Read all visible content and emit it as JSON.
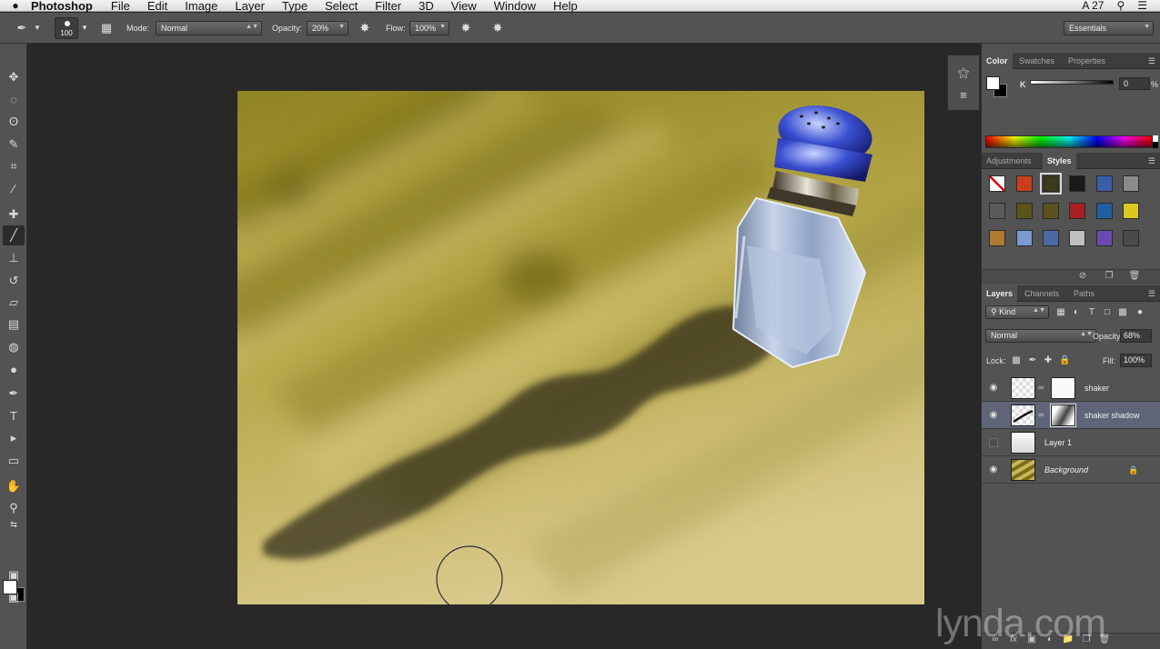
{
  "app": {
    "apple_icon": "apple-logo",
    "name": "Photoshop",
    "menus": [
      "File",
      "Edit",
      "Image",
      "Layer",
      "Type",
      "Select",
      "Filter",
      "3D",
      "View",
      "Window",
      "Help"
    ],
    "status_right": {
      "adobe_label": "A 27",
      "search_icon": "search-icon",
      "list_icon": "list-icon"
    }
  },
  "options_bar": {
    "brush_size": "100",
    "mode_label": "Mode:",
    "mode_value": "Normal",
    "opacity_label": "Opacity:",
    "opacity_value": "20%",
    "flow_label": "Flow:",
    "flow_value": "100%",
    "workspace": "Essentials"
  },
  "tools": [
    {
      "name": "move-tool",
      "glyph": "✥"
    },
    {
      "name": "marquee-tool",
      "glyph": "◌"
    },
    {
      "name": "lasso-tool",
      "glyph": "ʘ"
    },
    {
      "name": "quick-select-tool",
      "glyph": "✎"
    },
    {
      "name": "crop-tool",
      "glyph": "⌗"
    },
    {
      "name": "eyedropper-tool",
      "glyph": "⁄"
    },
    {
      "name": "healing-brush-tool",
      "glyph": "✚"
    },
    {
      "name": "brush-tool",
      "glyph": "╱",
      "active": true
    },
    {
      "name": "clone-stamp-tool",
      "glyph": "⊥"
    },
    {
      "name": "history-brush-tool",
      "glyph": "↺"
    },
    {
      "name": "eraser-tool",
      "glyph": "▱"
    },
    {
      "name": "gradient-tool",
      "glyph": "▤"
    },
    {
      "name": "blur-tool",
      "glyph": "◍"
    },
    {
      "name": "dodge-tool",
      "glyph": "●"
    },
    {
      "name": "pen-tool",
      "glyph": "✒"
    },
    {
      "name": "type-tool",
      "glyph": "T"
    },
    {
      "name": "path-select-tool",
      "glyph": "▸"
    },
    {
      "name": "shape-tool",
      "glyph": "▭"
    },
    {
      "name": "hand-tool",
      "glyph": "✋"
    },
    {
      "name": "zoom-tool",
      "glyph": "⚲"
    }
  ],
  "color_panel": {
    "tabs": [
      "Color",
      "Swatches",
      "Properties"
    ],
    "active_tab": "Color",
    "k_label": "K",
    "k_value": "0",
    "percent_label": "%"
  },
  "styles_panel": {
    "tabs": [
      "Adjustments",
      "Styles"
    ],
    "active_tab": "Styles",
    "swatch_colors": [
      "#ffffff",
      "#c8401a",
      "#3a3a1c",
      "#1a1a1a",
      "#3a5fa8",
      "#8a8a8a",
      "#5a5a5a",
      "#5a5418",
      "#5c5220",
      "#a82020",
      "#2060a0",
      "#d8c820",
      "#b07a30",
      "#7a9ad0",
      "#4a6aa0",
      "#c0c0c0",
      "#6a4ab0",
      "#4a4a4a"
    ]
  },
  "layers_panel": {
    "tabs": [
      "Layers",
      "Channels",
      "Paths"
    ],
    "active_tab": "Layers",
    "kind_label": "Kind",
    "blend_mode": "Normal",
    "opacity_label": "Opacity:",
    "opacity_value": "68%",
    "lock_label": "Lock:",
    "fill_label": "Fill:",
    "fill_value": "100%",
    "layers": [
      {
        "name": "shaker",
        "visible": true,
        "has_mask": true,
        "selected": false
      },
      {
        "name": "shaker shadow",
        "visible": true,
        "has_mask": true,
        "selected": true
      },
      {
        "name": "Layer 1",
        "visible": false,
        "has_mask": false,
        "selected": false
      },
      {
        "name": "Background",
        "visible": true,
        "has_mask": false,
        "selected": false,
        "locked": true
      }
    ]
  },
  "watermark": "lynda.com"
}
